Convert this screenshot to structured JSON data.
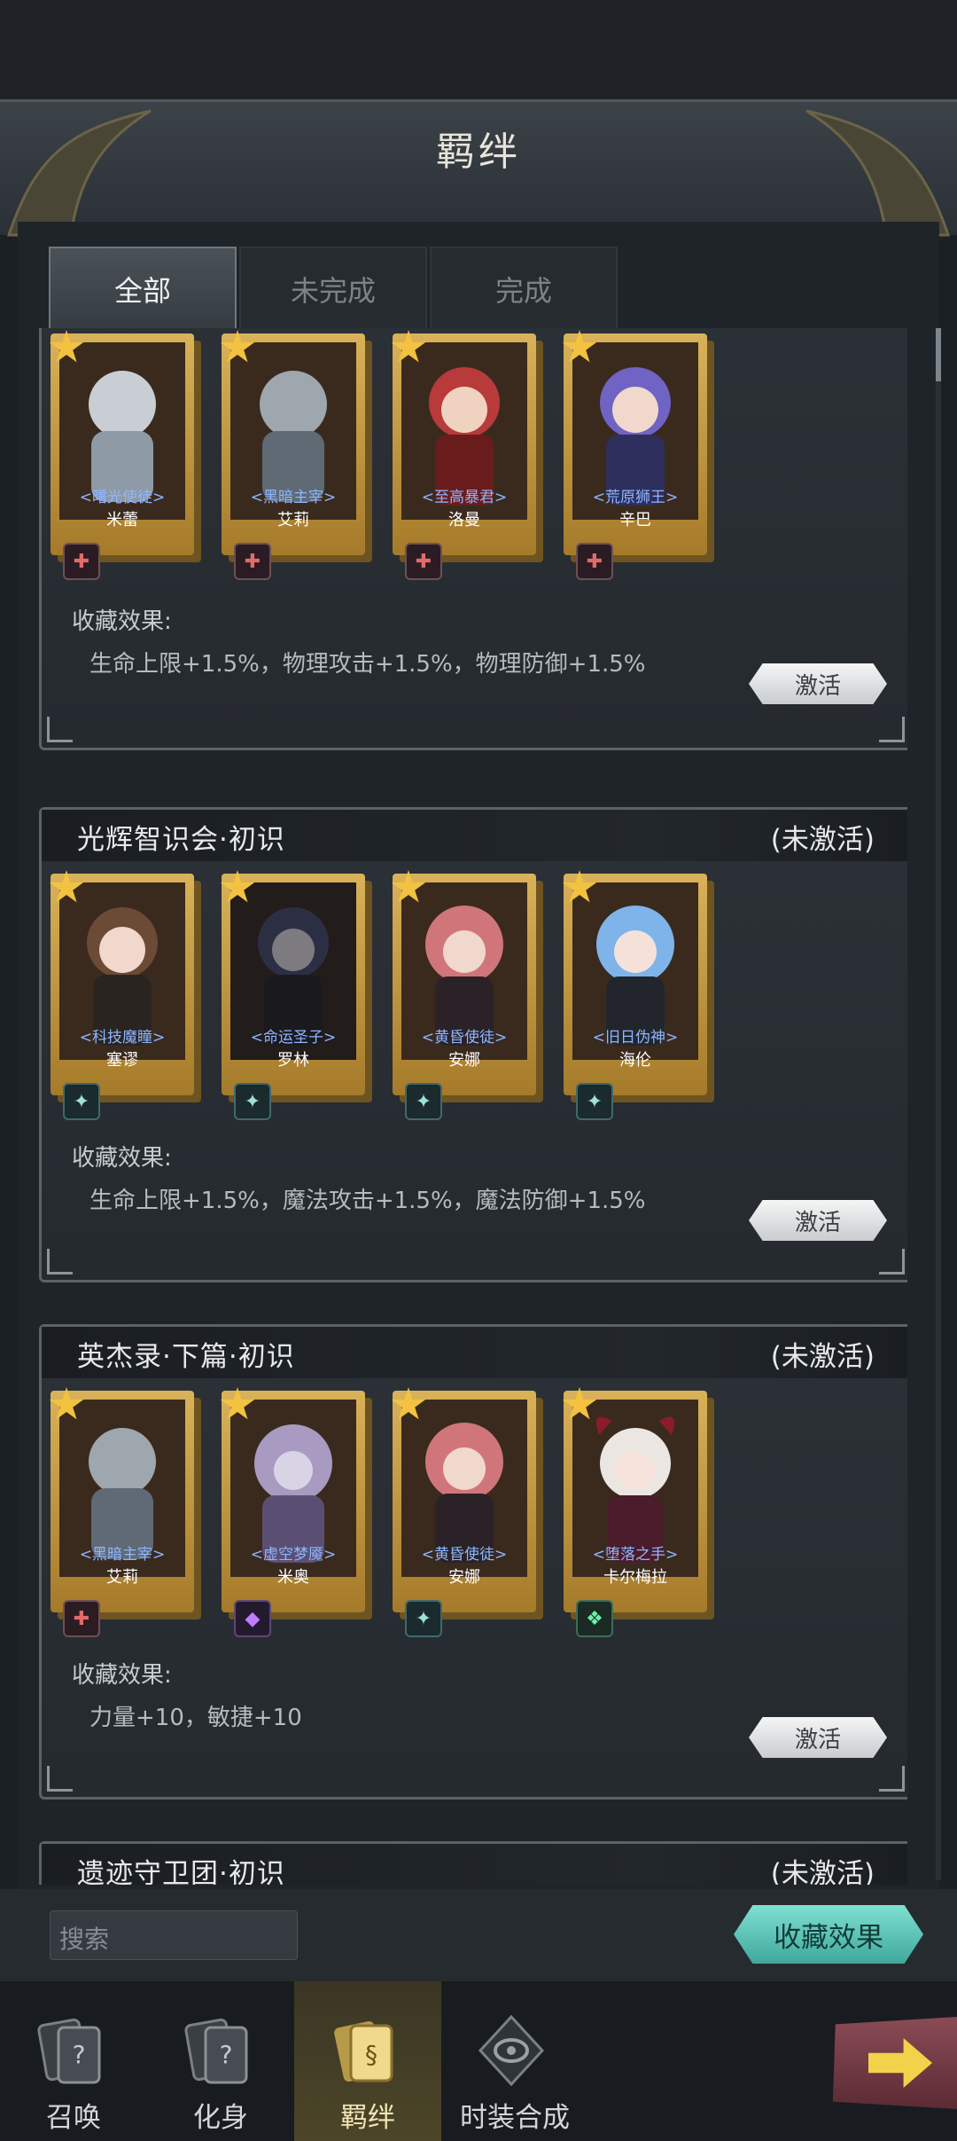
{
  "header": {
    "title": "羁绊"
  },
  "tabs": [
    {
      "label": "全部",
      "active": true
    },
    {
      "label": "未完成",
      "active": false
    },
    {
      "label": "完成",
      "active": false
    }
  ],
  "cards": [
    {
      "title": "",
      "status": "",
      "characters": [
        {
          "subtitle": "<曙光使徒>",
          "name": "米蕾",
          "badge": "warrior-icon"
        },
        {
          "subtitle": "<黑暗主宰>",
          "name": "艾莉",
          "badge": "warrior-icon"
        },
        {
          "subtitle": "<至高暴君>",
          "name": "洛曼",
          "badge": "warrior-icon"
        },
        {
          "subtitle": "<荒原狮王>",
          "name": "辛巴",
          "badge": "warrior-icon"
        }
      ],
      "effect_label": "收藏效果:",
      "effect_text": "生命上限+1.5%，物理攻击+1.5%，物理防御+1.5%",
      "button": "激活"
    },
    {
      "title": "光辉智识会·初识",
      "status": "(未激活)",
      "characters": [
        {
          "subtitle": "<科技魔瞳>",
          "name": "塞谬",
          "badge": "mage-icon"
        },
        {
          "subtitle": "<命运圣子>",
          "name": "罗林",
          "badge": "mage-icon"
        },
        {
          "subtitle": "<黄昏使徒>",
          "name": "安娜",
          "badge": "mage-icon"
        },
        {
          "subtitle": "<旧日伪神>",
          "name": "海伦",
          "badge": "mage-icon"
        }
      ],
      "effect_label": "收藏效果:",
      "effect_text": "生命上限+1.5%，魔法攻击+1.5%，魔法防御+1.5%",
      "button": "激活"
    },
    {
      "title": "英杰录·下篇·初识",
      "status": "(未激活)",
      "characters": [
        {
          "subtitle": "<黑暗主宰>",
          "name": "艾莉",
          "badge": "warrior-icon"
        },
        {
          "subtitle": "<虚空梦魇>",
          "name": "米奥",
          "badge": "void-icon"
        },
        {
          "subtitle": "<黄昏使徒>",
          "name": "安娜",
          "badge": "mage-icon"
        },
        {
          "subtitle": "<堕落之手>",
          "name": "卡尔梅拉",
          "badge": "nature-icon"
        }
      ],
      "effect_label": "收藏效果:",
      "effect_text": "力量+10，敏捷+10",
      "button": "激活"
    },
    {
      "title": "遗迹守卫团·初识",
      "status": "(未激活)"
    }
  ],
  "search": {
    "placeholder": "搜索"
  },
  "effect_button": "收藏效果",
  "nav": [
    {
      "label": "召唤",
      "icon": "summon-icon"
    },
    {
      "label": "化身",
      "icon": "avatar-icon"
    },
    {
      "label": "羁绊",
      "icon": "bond-icon",
      "active": true
    },
    {
      "label": "时装合成",
      "icon": "costume-icon"
    }
  ],
  "next_button": {
    "icon": "arrow-right-icon"
  },
  "colors": {
    "accent": "#6fd3c6",
    "gold": "#d9b25a",
    "background": "#1b2024"
  }
}
